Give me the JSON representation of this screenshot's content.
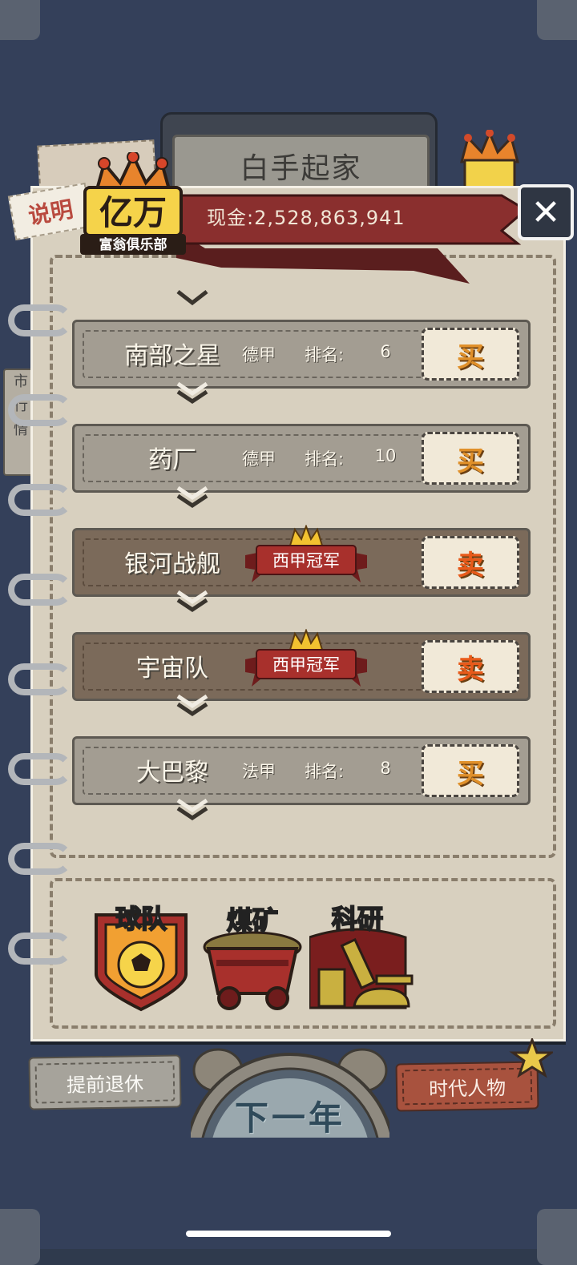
{
  "header": {
    "title": "白手起家",
    "explain_label": "说明",
    "cash_label": "现金:",
    "cash_value": "2,528,863,941",
    "close_glyph": "✕"
  },
  "logo": {
    "title": "亿万",
    "subtitle": "富翁俱乐部"
  },
  "side_tab": [
    "市",
    "行",
    "情"
  ],
  "teams": [
    {
      "name": "南部之星",
      "league": "德甲",
      "rank_label": "排名:",
      "rank": "6",
      "action": "买",
      "champion": false
    },
    {
      "name": "药厂",
      "league": "德甲",
      "rank_label": "排名:",
      "rank": "10",
      "action": "买",
      "champion": false
    },
    {
      "name": "银河战舰",
      "champion_label": "西甲冠军",
      "action": "卖",
      "champion": true
    },
    {
      "name": "宇宙队",
      "champion_label": "西甲冠军",
      "action": "卖",
      "champion": true
    },
    {
      "name": "大巴黎",
      "league": "法甲",
      "rank_label": "排名:",
      "rank": "8",
      "action": "买",
      "champion": false
    }
  ],
  "categories": [
    {
      "label": "球队",
      "icon": "soccer-shield-icon"
    },
    {
      "label": "煤矿",
      "icon": "mine-cart-icon"
    },
    {
      "label": "科研",
      "icon": "microscope-icon"
    }
  ],
  "footer": {
    "retire_label": "提前退休",
    "next_year_label": "下一年",
    "people_label": "时代人物"
  },
  "colors": {
    "background": "#34405a",
    "paper": "#d8d0bf",
    "banner_red": "#8a2f2e",
    "buy_orange": "#e0902a",
    "sell_orange": "#e85a1a"
  }
}
